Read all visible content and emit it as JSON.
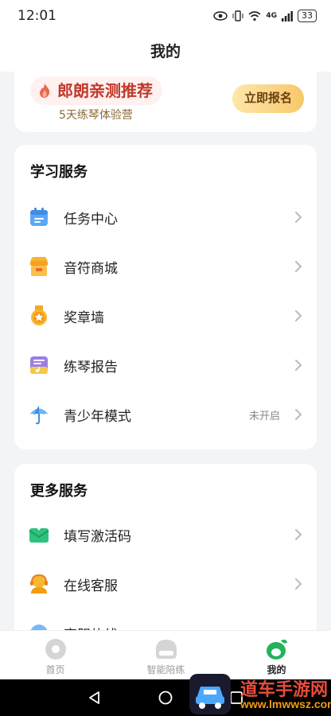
{
  "status": {
    "time": "12:01",
    "signal": "4G",
    "battery": "33"
  },
  "page_title": "我的",
  "promo": {
    "tag": "郎朗亲测推荐",
    "subtitle": "5天练琴体验营",
    "button": "立即报名"
  },
  "learning": {
    "title": "学习服务",
    "items": [
      {
        "label": "任务中心",
        "value": "",
        "icon": "calendar-icon"
      },
      {
        "label": "音符商城",
        "value": "",
        "icon": "shop-icon"
      },
      {
        "label": "奖章墙",
        "value": "",
        "icon": "medal-icon"
      },
      {
        "label": "练琴报告",
        "value": "",
        "icon": "report-icon"
      },
      {
        "label": "青少年模式",
        "value": "未开启",
        "icon": "umbrella-icon"
      }
    ]
  },
  "more": {
    "title": "更多服务",
    "items": [
      {
        "label": "填写激活码",
        "icon": "envelope-icon"
      },
      {
        "label": "在线客服",
        "icon": "support-agent-icon"
      },
      {
        "label": "客服热线",
        "icon": "phone-icon"
      }
    ]
  },
  "tabs": [
    {
      "label": "首页",
      "active": false
    },
    {
      "label": "智能陪练",
      "active": false
    },
    {
      "label": "我的",
      "active": true
    }
  ],
  "watermark": {
    "title": "道车手游网",
    "url": "www.lmwwsz.com"
  },
  "colors": {
    "accent_green": "#22b35b",
    "promo_gold": "#f8c86a",
    "background": "#f3f4f6"
  }
}
